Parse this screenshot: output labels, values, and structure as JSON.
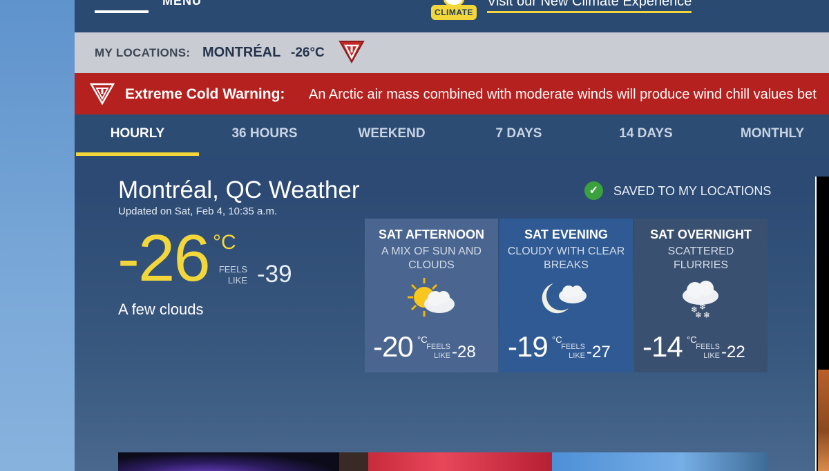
{
  "header": {
    "menu_label": "MENU",
    "climate_badge": "CLIMATE",
    "climate_link": "Visit our New Climate Experience"
  },
  "locations": {
    "label": "MY LOCATIONS:",
    "city": "MONTRÉAL",
    "temp": "-26°C"
  },
  "warning": {
    "title": "Extreme Cold Warning:",
    "text": "An Arctic air mass combined with moderate winds will produce wind chill values bet"
  },
  "tabs": [
    {
      "label": "HOURLY",
      "active": true
    },
    {
      "label": "36 HOURS",
      "active": false
    },
    {
      "label": "WEEKEND",
      "active": false
    },
    {
      "label": "7 DAYS",
      "active": false
    },
    {
      "label": "14 DAYS",
      "active": false
    },
    {
      "label": "MONTHLY",
      "active": false
    }
  ],
  "current": {
    "title": "Montréal, QC Weather",
    "updated": "Updated on Sat, Feb 4, 10:35 a.m.",
    "temp": "-26",
    "unit": "°C",
    "feels_label": "FEELS LIKE",
    "feels_value": "-39",
    "condition": "A few clouds"
  },
  "saved": {
    "check": "✓",
    "text": "SAVED TO MY LOCATIONS"
  },
  "forecast": [
    {
      "period": "SAT AFTERNOON",
      "desc": "A MIX OF SUN AND CLOUDS",
      "icon": "sun-cloud-icon",
      "temp": "-20",
      "unit": "°C",
      "feels_label": "FEELS LIKE",
      "feels": "-28",
      "bg": "#4a6690"
    },
    {
      "period": "SAT EVENING",
      "desc": "CLOUDY WITH CLEAR BREAKS",
      "icon": "moon-cloud-icon",
      "temp": "-19",
      "unit": "°C",
      "feels_label": "FEELS LIKE",
      "feels": "-27",
      "bg": "#2f5a93"
    },
    {
      "period": "SAT OVERNIGHT",
      "desc": "SCATTERED FLURRIES",
      "icon": "snow-cloud-icon",
      "temp": "-14",
      "unit": "°C",
      "feels_label": "FEELS LIKE",
      "feels": "-22",
      "bg": "#3a5070"
    }
  ],
  "colors": {
    "accent": "#f3d73a",
    "warning": "#b5211e",
    "header": "#2a4a72"
  }
}
